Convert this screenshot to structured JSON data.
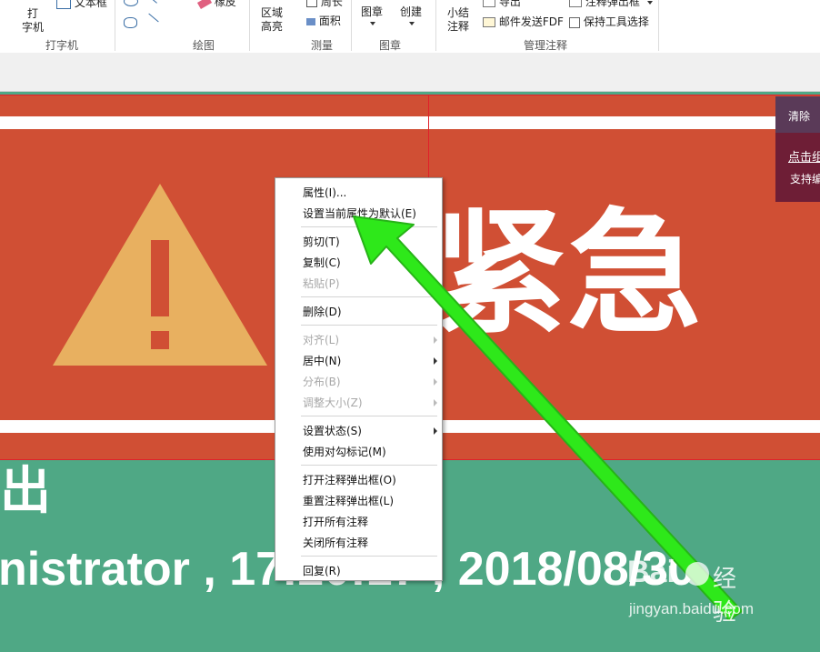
{
  "ribbon": {
    "typewriter_label": "打\n字机",
    "textbox_label": "文本框",
    "eraser_label": "橡皮",
    "area_height_label": "区域\n高亮",
    "perimeter_label": "周长",
    "area_label": "面积",
    "stamp_label": "图章",
    "create_label": "创建",
    "summary_label": "小结\n注释",
    "export_label": "导出",
    "email_fdf_label": "邮件发送FDF",
    "annot_popup_label": "注释弹出框",
    "keep_tool_label": "保持工具选择",
    "groups": {
      "typewriter": "打字机",
      "drawing": "绘图",
      "measure": "测量",
      "stamp": "图章",
      "manage": "管理注释"
    }
  },
  "document": {
    "urgent_text": "紧急",
    "author_line": "nistrator , 17:20:17 , 2018/08/30",
    "top_fragment": "出"
  },
  "right_panel": {
    "clear_label": "清除",
    "click_label": "点击组",
    "support_label": "支持编"
  },
  "context_menu": {
    "items": [
      {
        "label": "属性(I)...",
        "enabled": true
      },
      {
        "label": "设置当前属性为默认(E)",
        "enabled": true
      },
      {
        "label": "剪切(T)",
        "enabled": true
      },
      {
        "label": "复制(C)",
        "enabled": true
      },
      {
        "label": "粘贴(P)",
        "enabled": false
      },
      {
        "label": "删除(D)",
        "enabled": true
      },
      {
        "label": "对齐(L)",
        "enabled": false
      },
      {
        "label": "居中(N)",
        "enabled": true
      },
      {
        "label": "分布(B)",
        "enabled": false
      },
      {
        "label": "调整大小(Z)",
        "enabled": false
      },
      {
        "label": "设置状态(S)",
        "enabled": true
      },
      {
        "label": "使用对勾标记(M)",
        "enabled": true
      },
      {
        "label": "打开注释弹出框(O)",
        "enabled": true
      },
      {
        "label": "重置注释弹出框(L)",
        "enabled": true
      },
      {
        "label": "打开所有注释",
        "enabled": true
      },
      {
        "label": "关闭所有注释",
        "enabled": true
      },
      {
        "label": "回复(R)",
        "enabled": true
      }
    ]
  },
  "watermark": {
    "brand": "Bai",
    "brand2": "经验",
    "url": "jingyan.baidu.com"
  },
  "colors": {
    "banner_red": "#d04f34",
    "triangle": "#e8b060",
    "background_green": "#4fa885",
    "arrow": "#2ee81a"
  }
}
